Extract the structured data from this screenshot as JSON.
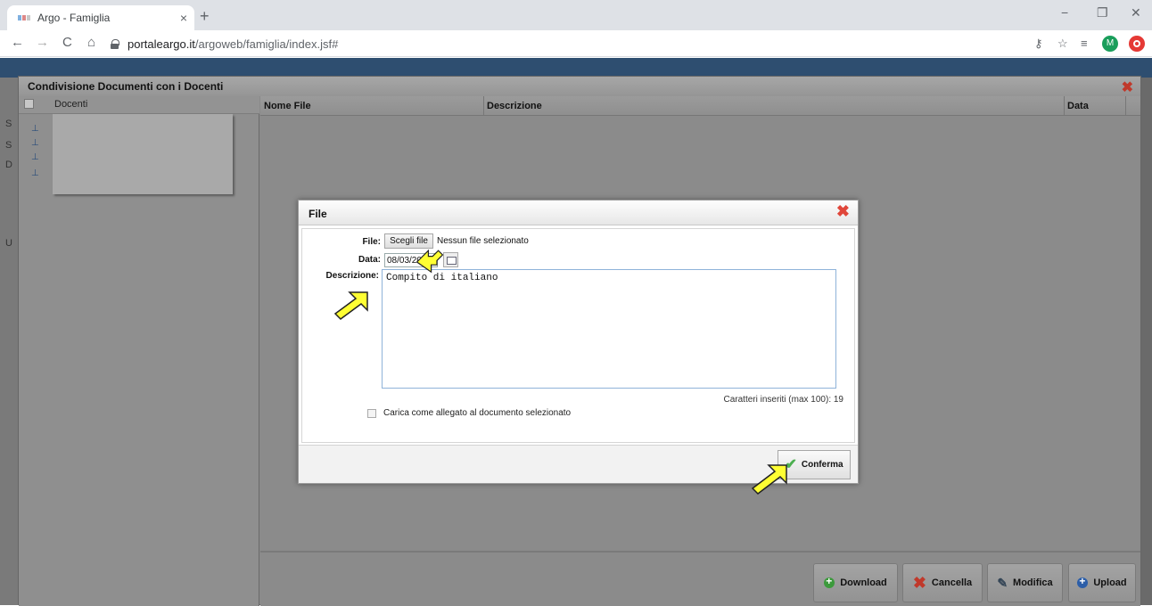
{
  "browser": {
    "tab_title": "Argo - Famiglia",
    "tab_close": "×",
    "new_tab": "+",
    "url_host": "portaleargo.it",
    "url_path": "/argoweb/famiglia/index.jsf#",
    "avatar_letter": "M",
    "win_min": "−",
    "win_max": "❐",
    "win_close": "✕"
  },
  "page_edge_letters": [
    "S",
    "S",
    "D",
    "U"
  ],
  "main_dialog": {
    "title": "Condivisione Documenti con i Docenti",
    "close_icon": "✖",
    "tree": {
      "header": "Docenti",
      "items_count_visible": 4
    },
    "grid": {
      "columns": [
        "Nome File",
        "Descrizione",
        "Data"
      ]
    },
    "buttons": {
      "download": "Download",
      "cancella": "Cancella",
      "modifica": "Modifica",
      "upload": "Upload"
    }
  },
  "file_modal": {
    "title": "File",
    "close_icon": "✖",
    "file_label": "File:",
    "choose_button": "Scegli file",
    "no_file_text": "Nessun file selezionato",
    "date_label": "Data:",
    "date_value": "08/03/2020",
    "description_label": "Descrizione:",
    "description_value": "Compito di italiano",
    "counter_text": "Caratteri inseriti (max 100): 19",
    "attach_label": "Carica come allegato al documento selezionato",
    "attach_checked": false,
    "confirm_button": "Conferma"
  },
  "colors": {
    "accent_close": "#e0463a",
    "arrow_fill": "#ffff33",
    "confirm_check": "#4caf50"
  }
}
